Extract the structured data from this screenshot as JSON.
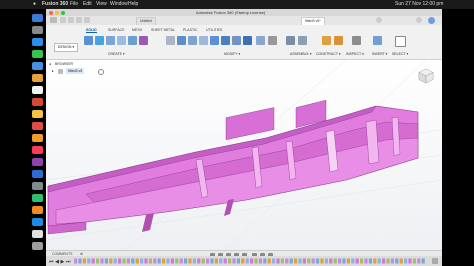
{
  "menubar": {
    "app_name": "Fusion 360",
    "items": [
      "File",
      "Edit",
      "View",
      "Window",
      "Help"
    ],
    "clock": "Sun 27 Nov  12:00 pm"
  },
  "window": {
    "title": "Autodesk Fusion 360 (Startup License)",
    "tabs": [
      {
        "label": "Untitled",
        "active": false
      },
      {
        "label": "fitted3 v5*",
        "active": true
      }
    ]
  },
  "toolbar": {
    "workspace_button": "DESIGN ▾",
    "workspace_tabs": [
      {
        "label": "SOLID",
        "active": true
      },
      {
        "label": "SURFACE",
        "active": false
      },
      {
        "label": "MESH",
        "active": false
      },
      {
        "label": "SHEET METAL",
        "active": false
      },
      {
        "label": "PLASTIC",
        "active": false
      },
      {
        "label": "UTILITIES",
        "active": false
      }
    ],
    "groups": [
      {
        "label": "CREATE ▾"
      },
      {
        "label": "MODIFY ▾"
      },
      {
        "label": "ASSEMBLE ▾"
      },
      {
        "label": "CONSTRUCT ▾"
      },
      {
        "label": "INSPECT ▾"
      },
      {
        "label": "INSERT ▾"
      },
      {
        "label": "SELECT ▾"
      }
    ]
  },
  "browser": {
    "label": "BROWSER",
    "root_item": "fitted3 v5"
  },
  "bottom": {
    "comments_label": "COMMENTS"
  },
  "colors": {
    "part_fill": "#e27de0",
    "part_shadow": "#c45ec4",
    "accent": "#0a5fb4"
  }
}
